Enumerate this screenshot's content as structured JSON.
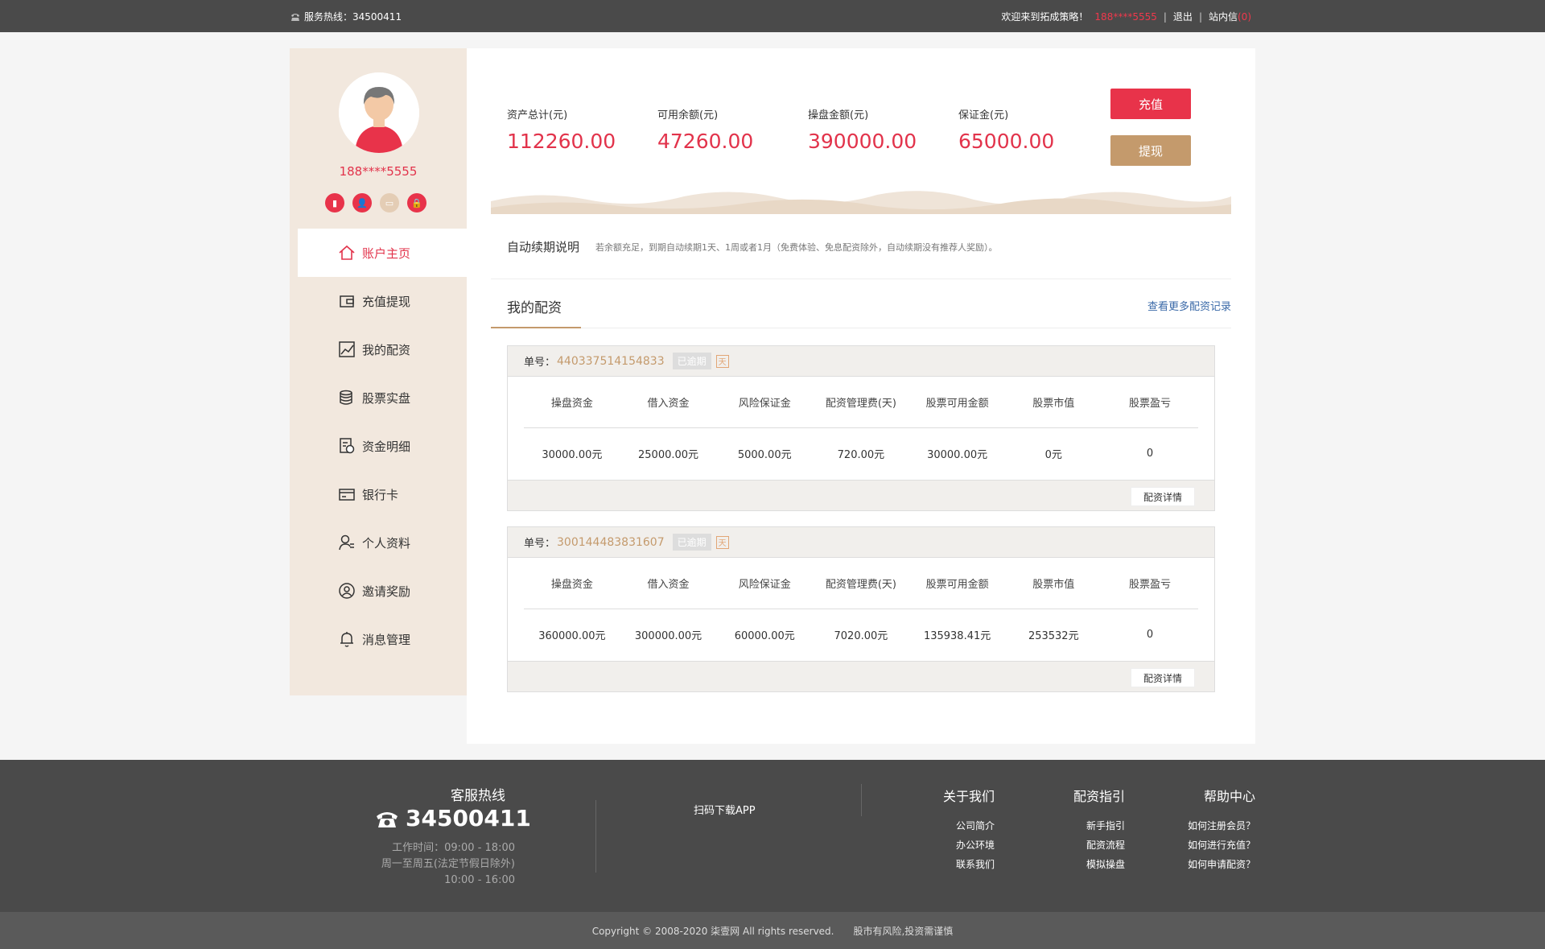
{
  "topbar": {
    "hotline_label": "服务热线：34500411",
    "welcome": "欢迎来到拓成策略！",
    "user_phone": "188****5555",
    "logout": "退出",
    "sep": "|",
    "inbox": "站内信",
    "inbox_count": "(0)"
  },
  "profile": {
    "phone": "188****5555"
  },
  "menu": [
    {
      "label": "账户主页",
      "icon": "home-icon"
    },
    {
      "label": "充值提现",
      "icon": "wallet-icon"
    },
    {
      "label": "我的配资",
      "icon": "chart-icon"
    },
    {
      "label": "股票实盘",
      "icon": "coins-icon"
    },
    {
      "label": "资金明细",
      "icon": "ledger-icon"
    },
    {
      "label": "银行卡",
      "icon": "card-icon"
    },
    {
      "label": "个人资料",
      "icon": "user-icon"
    },
    {
      "label": "邀请奖励",
      "icon": "invite-icon"
    },
    {
      "label": "消息管理",
      "icon": "bell-icon"
    }
  ],
  "stats": {
    "total_label": "资产总计(元)",
    "total_value": "112260.00",
    "available_label": "可用余额(元)",
    "available_value": "47260.00",
    "trading_label": "操盘金额(元)",
    "trading_value": "390000.00",
    "margin_label": "保证金(元)",
    "margin_value": "65000.00"
  },
  "buttons": {
    "recharge": "充值",
    "withdraw": "提现"
  },
  "autorenew": {
    "title": "自动续期说明",
    "desc": "若余额充足，到期自动续期1天、1周或者1月（免费体验、免息配资除外，自动续期没有推荐人奖励）。"
  },
  "section": {
    "title": "我的配资",
    "more": "查看更多配资记录"
  },
  "table_headers": [
    "操盘资金",
    "借入资金",
    "风险保证金",
    "配资管理费(天)",
    "股票可用金额",
    "股票市值",
    "股票盈亏"
  ],
  "orders": [
    {
      "label": "单号：",
      "number": "440337514154833",
      "status": "已逾期",
      "period": "天",
      "values": [
        "30000.00元",
        "25000.00元",
        "5000.00元",
        "720.00元",
        "30000.00元",
        "0元",
        "0"
      ],
      "detail": "配资详情"
    },
    {
      "label": "单号：",
      "number": "300144483831607",
      "status": "已逾期",
      "period": "天",
      "values": [
        "360000.00元",
        "300000.00元",
        "60000.00元",
        "7020.00元",
        "135938.41元",
        "253532元",
        "0"
      ],
      "detail": "配资详情"
    }
  ],
  "footer": {
    "cs_title": "客服热线",
    "cs_phone": "34500411",
    "work_time": "工作时间：09:00 - 18:00",
    "work_days": "周一至周五(法定节假日除外)",
    "work_time2": "10:00 - 16:00",
    "qr_text": "扫码下载APP",
    "cols": [
      {
        "title": "关于我们",
        "links": [
          "公司简介",
          "办公环境",
          "联系我们"
        ]
      },
      {
        "title": "配资指引",
        "links": [
          "新手指引",
          "配资流程",
          "模拟操盘"
        ]
      },
      {
        "title": "帮助中心",
        "links": [
          "如何注册会员？",
          "如何进行充值？",
          "如何申请配资？"
        ]
      }
    ],
    "copyright": "Copyright © 2008-2020 柒壹网 All rights reserved.",
    "risk": "股市有风险,投资需谨慎"
  },
  "colors": {
    "accent_red": "#e8334a",
    "accent_gold": "#c49a6c",
    "sidebar_bg": "#f2e8de"
  }
}
